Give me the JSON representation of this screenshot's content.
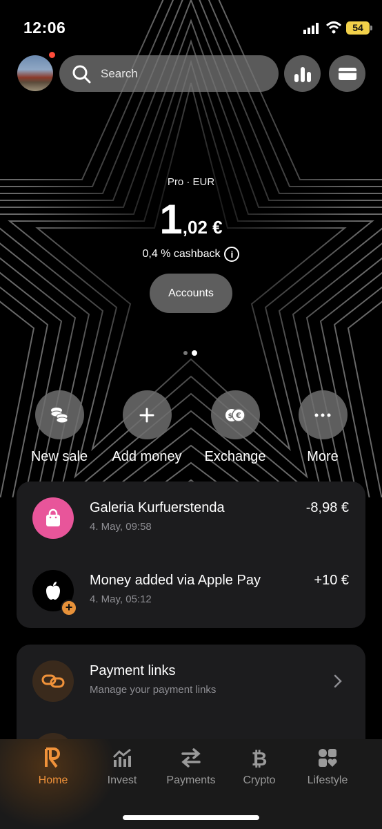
{
  "status_bar": {
    "time": "12:06",
    "battery": "54"
  },
  "header": {
    "search_placeholder": "Search"
  },
  "balance": {
    "account_label": "Pro · EUR",
    "amount_whole": "1",
    "amount_fraction": ",02 €",
    "cashback": "0,4 % cashback",
    "accounts_button": "Accounts",
    "page_indicator": {
      "count": 2,
      "active": 2
    }
  },
  "actions": [
    {
      "label": "New sale",
      "icon": "coins-icon"
    },
    {
      "label": "Add money",
      "icon": "plus-icon"
    },
    {
      "label": "Exchange",
      "icon": "exchange-icon"
    },
    {
      "label": "More",
      "icon": "more-dots-icon"
    }
  ],
  "transactions": [
    {
      "name": "Galeria Kurfuerstenda",
      "date": "4. May, 09:58",
      "amount": "-8,98 €",
      "icon": "shopping-bag-icon",
      "icon_color": "#e8559a"
    },
    {
      "name": "Money added via Apple Pay",
      "date": "4. May, 05:12",
      "amount": "+10 €",
      "icon": "apple-icon",
      "icon_color": "#000000",
      "badge": "+"
    }
  ],
  "payment_links": {
    "title": "Payment links",
    "subtitle": "Manage your payment links"
  },
  "tabs": [
    {
      "label": "Home",
      "icon": "revolut-r-icon",
      "active": true
    },
    {
      "label": "Invest",
      "icon": "invest-chart-icon",
      "active": false
    },
    {
      "label": "Payments",
      "icon": "payments-arrows-icon",
      "active": false
    },
    {
      "label": "Crypto",
      "icon": "bitcoin-icon",
      "active": false
    },
    {
      "label": "Lifestyle",
      "icon": "lifestyle-icon",
      "active": false
    }
  ],
  "colors": {
    "accent": "#f0923a",
    "card_bg": "#1c1c1e",
    "badge": "#e8923a"
  }
}
